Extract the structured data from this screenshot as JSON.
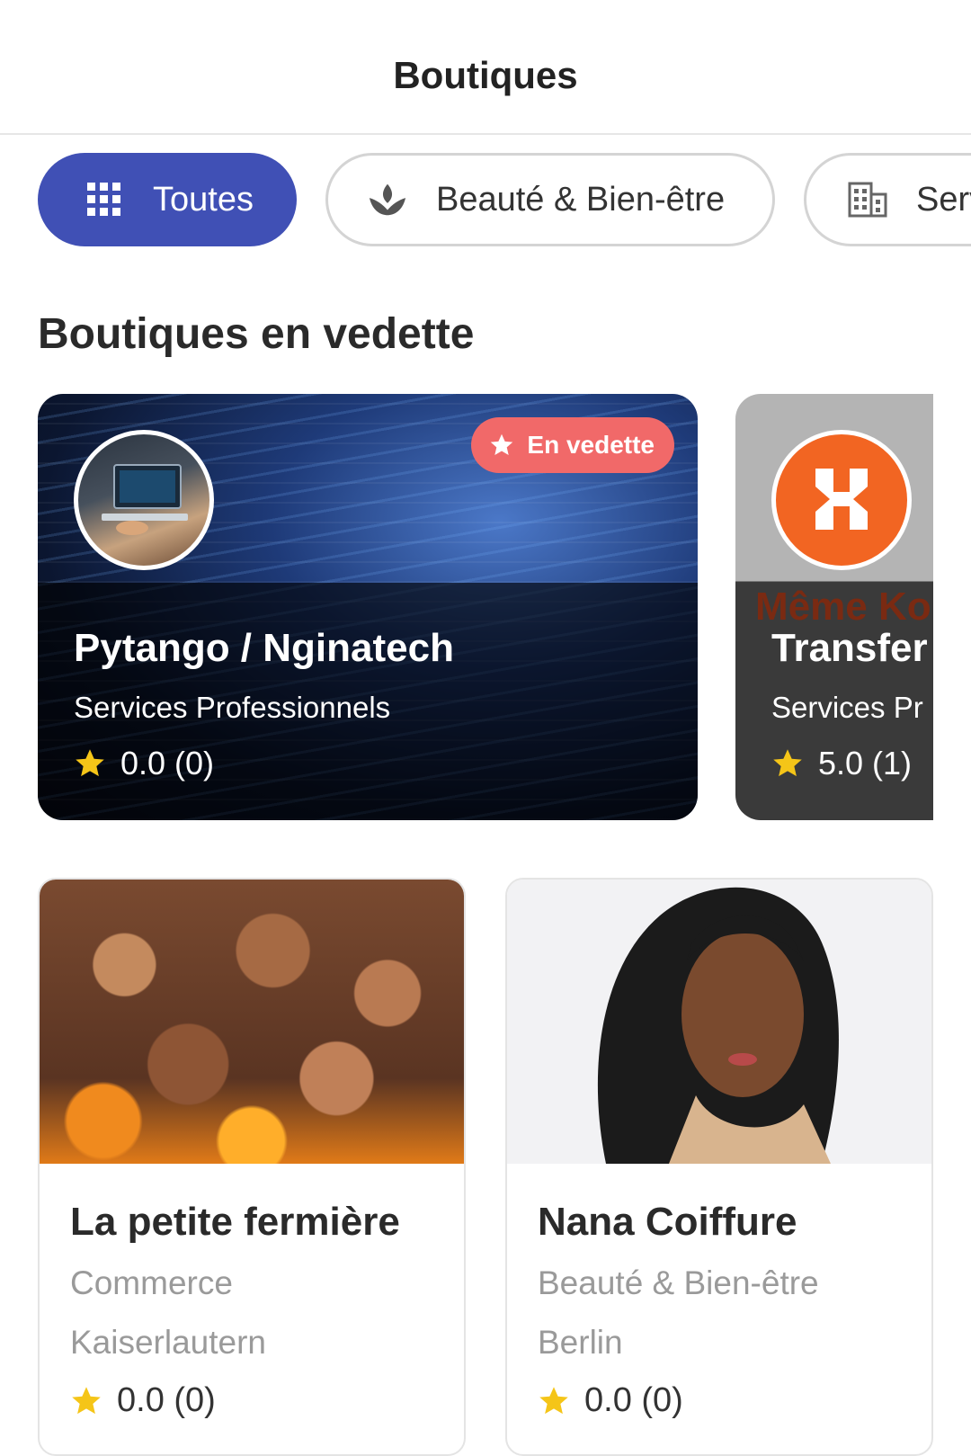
{
  "header": {
    "title": "Boutiques"
  },
  "categories": [
    {
      "label": "Toutes",
      "icon": "grid-icon",
      "active": true
    },
    {
      "label": "Beauté & Bien-être",
      "icon": "lotus-icon",
      "active": false
    },
    {
      "label": "Serv",
      "icon": "building-icon",
      "active": false
    }
  ],
  "featured": {
    "title": "Boutiques en vedette",
    "items": [
      {
        "name": "Pytango / Nginatech",
        "category": "Services Professionnels",
        "rating": "0.0 (0)",
        "badge": "En vedette"
      },
      {
        "name": "Transfer",
        "category": "Services Pr",
        "rating": "5.0 (1)",
        "bg_text": "Même Ko"
      }
    ]
  },
  "shops": [
    {
      "name": "La petite fermière",
      "category": "Commerce",
      "city": "Kaiserlautern",
      "rating": "0.0 (0)"
    },
    {
      "name": "Nana Coiffure",
      "category": "Beauté & Bien-être",
      "city": "Berlin",
      "rating": "0.0 (0)"
    }
  ],
  "colors": {
    "accent": "#4050b5",
    "badge": "#f16969",
    "star": "#f5c518",
    "logo_orange": "#f26522"
  }
}
